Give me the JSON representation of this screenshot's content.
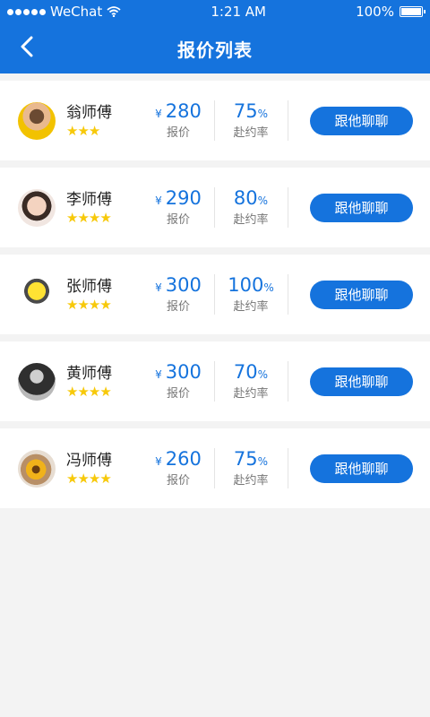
{
  "status": {
    "carrier": "WeChat",
    "time": "1:21 AM",
    "battery": "100%"
  },
  "nav": {
    "title": "报价列表",
    "back_icon": "chevron-left-icon"
  },
  "labels": {
    "price_sub": "报价",
    "rate_sub": "赴约率",
    "currency": "¥",
    "percent": "%",
    "chat_button": "跟他聊聊"
  },
  "colors": {
    "primary": "#1573dd",
    "star": "#f7c90a"
  },
  "quotes": [
    {
      "name": "翁师傅",
      "stars": 3,
      "price": "280",
      "rate": "75"
    },
    {
      "name": "李师傅",
      "stars": 4,
      "price": "290",
      "rate": "80"
    },
    {
      "name": "张师傅",
      "stars": 4,
      "price": "300",
      "rate": "100"
    },
    {
      "name": "黄师傅",
      "stars": 4,
      "price": "300",
      "rate": "70"
    },
    {
      "name": "冯师傅",
      "stars": 4,
      "price": "260",
      "rate": "75"
    }
  ]
}
